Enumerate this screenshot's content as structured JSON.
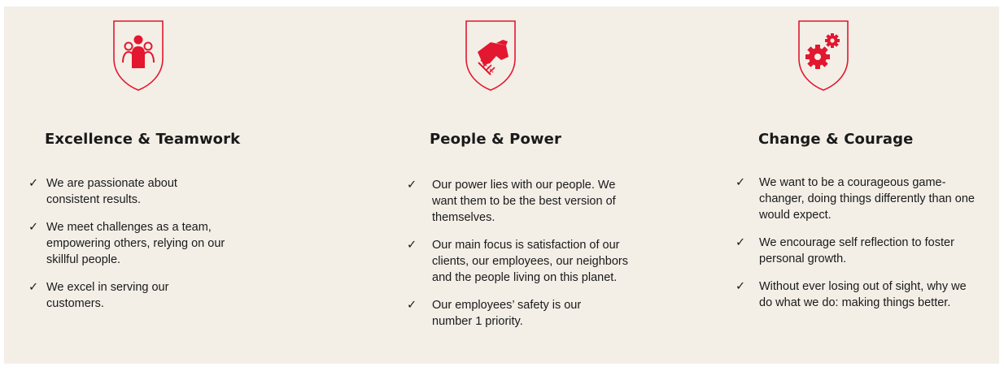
{
  "columns": [
    {
      "title": "Excellence & Teamwork",
      "icon": "team-icon",
      "bullets": [
        "We are passionate about consistent results.",
        "We meet challenges as a team, empowering others, relying on our skillful people.",
        "We excel in serving our customers."
      ]
    },
    {
      "title": "People & Power",
      "icon": "handshake-icon",
      "bullets": [
        "Our power lies with our people. We want them to be the best version of themselves.",
        "Our main focus is satisfaction of our clients, our employees, our neighbors and the people living on this planet.",
        "Our employees’ safety is our number 1 priority."
      ]
    },
    {
      "title": "Change & Courage",
      "icon": "gears-icon",
      "bullets": [
        "We want to be a courageous game-changer, doing things differently than one would expect.",
        "We encourage self reflection to foster personal growth.",
        "Without ever losing out of sight, why we do what we do: making things better."
      ]
    }
  ],
  "check_glyph": "✓",
  "colors": {
    "accent": "#e3172f",
    "background": "#f3efe7",
    "text": "#1a1a1a"
  }
}
